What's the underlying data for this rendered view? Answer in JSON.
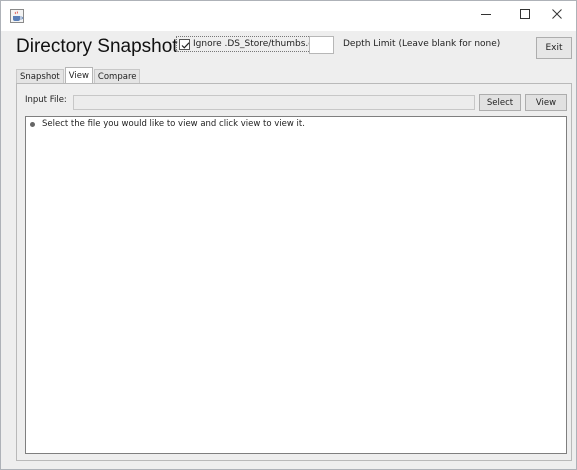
{
  "window": {
    "app_icon": "java-cup-icon",
    "minimize_icon": "minimize-icon",
    "maximize_icon": "maximize-icon",
    "close_icon": "close-icon"
  },
  "header": {
    "title": "Directory Snapshot",
    "ignore_checkbox_label": "Ignore .DS_Store/thumbs.db",
    "ignore_checked": true,
    "depth_value": "",
    "depth_label": "Depth Limit (Leave blank for none)",
    "exit_label": "Exit"
  },
  "tabs": [
    {
      "label": "Snapshot",
      "active": false
    },
    {
      "label": "View",
      "active": true
    },
    {
      "label": "Compare",
      "active": false
    }
  ],
  "view_panel": {
    "input_label": "Input File:",
    "input_value": "",
    "select_label": "Select",
    "view_label": "View",
    "list_items": [
      "Select the file you would like to view and click view to view it."
    ]
  }
}
